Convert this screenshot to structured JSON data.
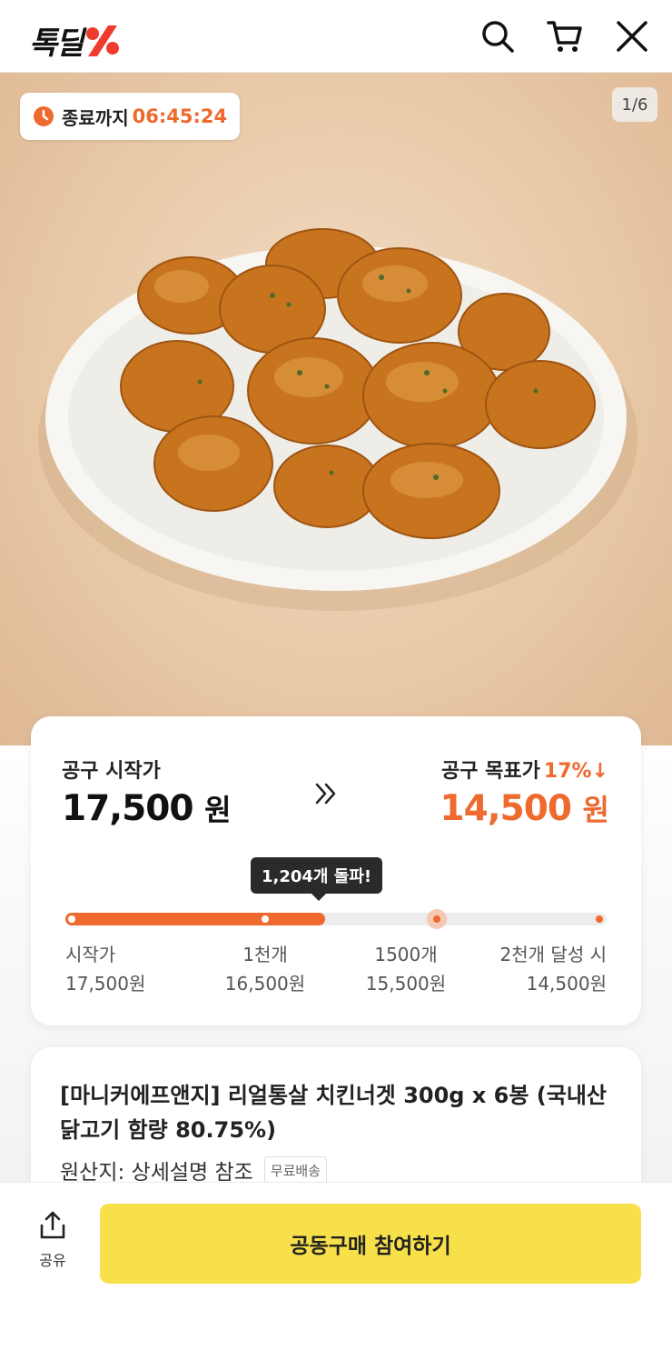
{
  "header": {
    "logo_text": "톡딜",
    "icons": [
      "search-icon",
      "cart-icon",
      "close-icon"
    ],
    "colors": {
      "brand": "#ee3b2e",
      "accent": "#ee6a2e"
    }
  },
  "hero": {
    "timer_label": "종료까지",
    "timer_value": "06:45:24",
    "pager": "1/6",
    "image": "chicken-nuggets-on-plate"
  },
  "price": {
    "start_label": "공구 시작가",
    "start_price": "17,500",
    "won": "원",
    "target_label": "공구 목표가",
    "target_discount": "17%↓",
    "target_price": "14,500",
    "tooltip": "1,204개 돌파!",
    "progress_fraction": 0.48,
    "milestones": [
      {
        "label": "시작가",
        "price": "17,500원"
      },
      {
        "label": "1천개",
        "price": "16,500원"
      },
      {
        "label": "1500개",
        "price": "15,500원"
      },
      {
        "label": "2천개 달성 시",
        "price": "14,500원"
      }
    ]
  },
  "product": {
    "title": "[마니커에프앤지] 리얼통살 치킨너겟 300g x 6봉 (국내산 닭고기 함량 80.75%)",
    "origin": "원산지: 상세설명 참조",
    "badge": "무료배송"
  },
  "bottom": {
    "share_label": "공유",
    "cta_label": "공동구매 참여하기",
    "cta_color": "#f8e04a"
  }
}
